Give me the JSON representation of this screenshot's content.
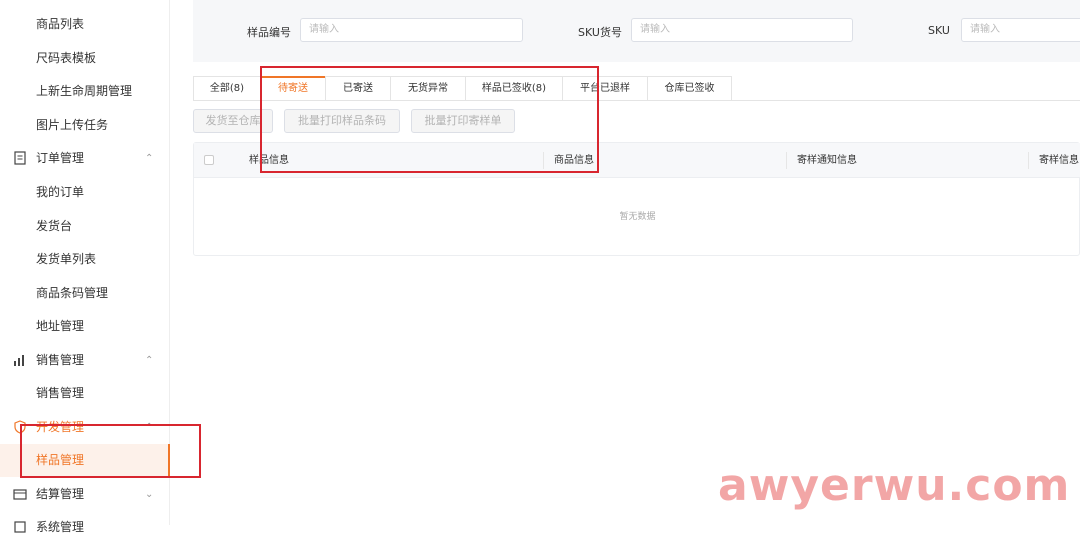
{
  "sidebar": {
    "items": [
      {
        "label": "商品列表"
      },
      {
        "label": "尺码表模板"
      },
      {
        "label": "上新生命周期管理"
      },
      {
        "label": "图片上传任务"
      }
    ],
    "order_group": {
      "label": "订单管理",
      "icon": "document-icon",
      "chevron": "^"
    },
    "order_items": [
      {
        "label": "我的订单"
      },
      {
        "label": "发货台"
      },
      {
        "label": "发货单列表"
      },
      {
        "label": "商品条码管理"
      },
      {
        "label": "地址管理"
      }
    ],
    "sales_group": {
      "label": "销售管理",
      "icon": "bar-chart-icon",
      "chevron": "^"
    },
    "sales_items": [
      {
        "label": "销售管理"
      }
    ],
    "dev_group": {
      "label": "开发管理",
      "icon": "shield-icon",
      "chevron": "^"
    },
    "dev_items": [
      {
        "label": "样品管理"
      }
    ],
    "settle_group": {
      "label": "结算管理",
      "icon": "wallet-icon",
      "chevron": "v"
    },
    "next_group": {
      "label": "系统管理"
    }
  },
  "filters": {
    "sample_no_label": "样品编号",
    "sample_no_placeholder": "请输入",
    "sku_code_label": "SKU货号",
    "sku_code_placeholder": "请输入",
    "sku_label": "SKU",
    "sku_placeholder": "请输入"
  },
  "tabs": [
    {
      "label": "全部(8)"
    },
    {
      "label": "待寄送"
    },
    {
      "label": "已寄送"
    },
    {
      "label": "无货异常"
    },
    {
      "label": "样品已签收(8)"
    },
    {
      "label": "平台已退样"
    },
    {
      "label": "仓库已签收"
    }
  ],
  "actions": {
    "ship_to_warehouse": "发货至仓库",
    "batch_print_barcode": "批量打印样品条码",
    "batch_print_sample_sheet": "批量打印寄样单"
  },
  "table": {
    "columns": [
      "样品信息",
      "商品信息",
      "寄样通知信息",
      "寄样信息"
    ],
    "empty_text": "暂无数据"
  },
  "watermark": "awyerwu.com",
  "colors": {
    "accent": "#f07628",
    "annotation": "#d8262f"
  }
}
